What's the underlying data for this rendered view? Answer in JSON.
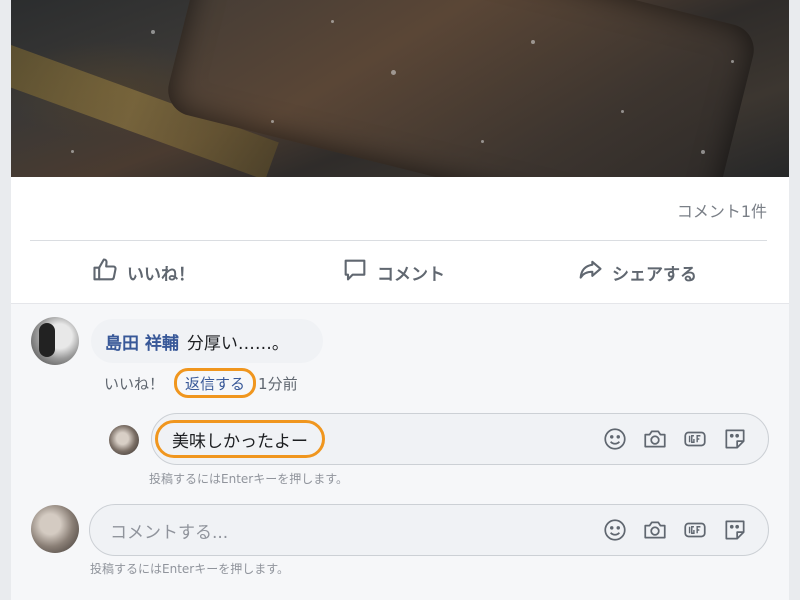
{
  "post": {
    "comment_count": "コメント1件"
  },
  "actions": {
    "like": "いいね！",
    "comment": "コメント",
    "share": "シェアする"
  },
  "comment": {
    "author": "島田 祥輔",
    "text": "分厚い……。",
    "like": "いいね！",
    "reply": "返信する",
    "time": "1分前"
  },
  "reply_box": {
    "value": "美味しかったよー",
    "hint": "投稿するにはEnterキーを押します。"
  },
  "comment_box": {
    "placeholder": "コメントする...",
    "hint": "投稿するにはEnterキーを押します。"
  },
  "colors": {
    "highlight": "#f0961e",
    "link": "#385898"
  },
  "icons": [
    "smile-icon",
    "camera-icon",
    "gif-icon",
    "sticker-icon"
  ]
}
